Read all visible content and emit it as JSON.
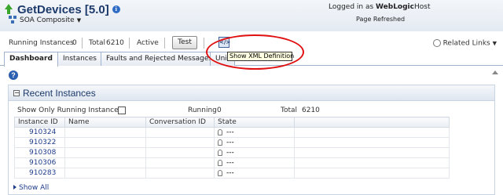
{
  "header": {
    "title": "GetDevices [5.0]",
    "composite_menu": "SOA Composite",
    "logged_in_prefix": "Logged in as",
    "logged_in_user": "WebLogic",
    "logged_in_suffix": "Host",
    "page_refreshed_label": "Page Refreshed"
  },
  "toolbar": {
    "running_label": "Running Instances",
    "running_value": "0",
    "total_label": "Total",
    "total_value": "6210",
    "status": "Active",
    "test_button": "Test",
    "related_links": "Related Links"
  },
  "tabs": [
    {
      "label": "Dashboard"
    },
    {
      "label": "Instances"
    },
    {
      "label": "Faults and Rejected Messages"
    },
    {
      "label": "Unit"
    }
  ],
  "tooltip": "Show XML Definition",
  "recent_instances": {
    "title": "Recent Instances",
    "show_running_label": "Show Only Running Instances",
    "running_label": "Running",
    "running_value": "0",
    "total_label": "Total",
    "total_value": "6210",
    "columns": [
      "Instance ID",
      "Name",
      "Conversation ID",
      "State"
    ],
    "rows": [
      {
        "id": "910324",
        "name": "",
        "conversation": "",
        "state": "---"
      },
      {
        "id": "910322",
        "name": "",
        "conversation": "",
        "state": "---"
      },
      {
        "id": "910308",
        "name": "",
        "conversation": "",
        "state": "---"
      },
      {
        "id": "910306",
        "name": "",
        "conversation": "",
        "state": "---"
      },
      {
        "id": "910283",
        "name": "",
        "conversation": "",
        "state": "---"
      }
    ],
    "show_all": "Show All"
  },
  "colors": {
    "accent": "#1c3a6b",
    "link": "#1f3d8b",
    "callout": "#e01010",
    "tooltip_bg": "#ffffe1"
  },
  "icons": [
    "up-arrow-icon",
    "info-icon",
    "soa-composite-icon",
    "xml-definition-icon",
    "paperclip-icon",
    "help-icon",
    "collapse-icon",
    "state-icon"
  ]
}
